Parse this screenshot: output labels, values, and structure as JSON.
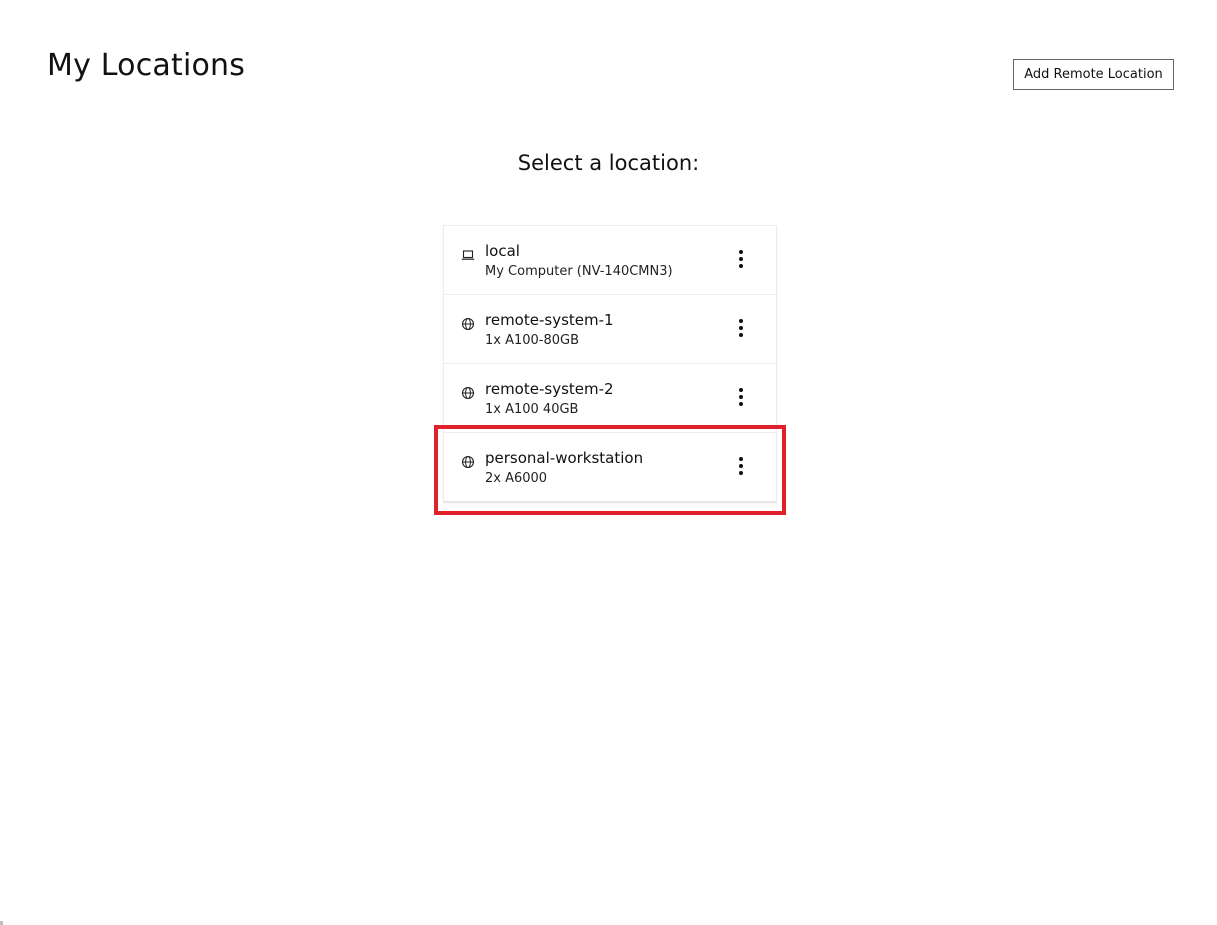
{
  "page": {
    "title": "My Locations",
    "add_button_label": "Add Remote Location",
    "section_heading": "Select a location:"
  },
  "locations": [
    {
      "name": "local",
      "description": "My Computer (NV-140CMN3)",
      "icon": "laptop-icon"
    },
    {
      "name": "remote-system-1",
      "description": "1x A100-80GB",
      "icon": "globe-icon"
    },
    {
      "name": "remote-system-2",
      "description": "1x A100 40GB",
      "icon": "globe-icon"
    },
    {
      "name": "personal-workstation",
      "description": "2x A6000",
      "icon": "globe-icon"
    }
  ],
  "highlight": {
    "target": "personal-workstation",
    "color": "#e0202a"
  },
  "colors": {
    "text": "#111111",
    "border": "#d8d8d8",
    "background": "#ffffff"
  }
}
